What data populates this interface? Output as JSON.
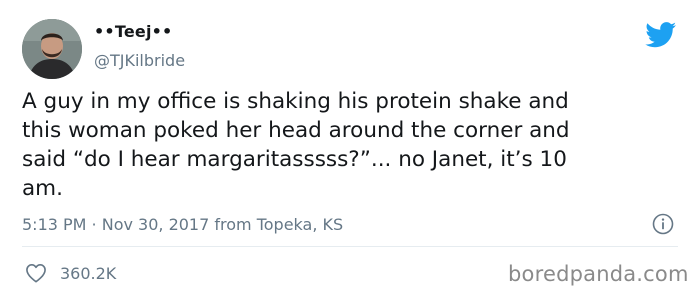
{
  "tweet": {
    "display_name": "••Teej••",
    "handle": "@TJKilbride",
    "text_lines": [
      "A guy in my office is shaking his protein shake and",
      "this woman poked her head around the corner and",
      "said “do I hear margaritasssss?”... no Janet, it’s 10",
      "am."
    ],
    "timestamp": "5:13 PM · Nov 30, 2017 from Topeka, KS",
    "likes": "360.2K"
  },
  "icons": {
    "brand": "twitter-bird-icon",
    "info": "info-icon",
    "like": "heart-icon"
  },
  "colors": {
    "twitter_blue": "#1da1f2",
    "secondary_text": "#657786",
    "primary_text": "#14171a",
    "divider": "#e6ecf0"
  },
  "watermark": "boredpanda.com"
}
